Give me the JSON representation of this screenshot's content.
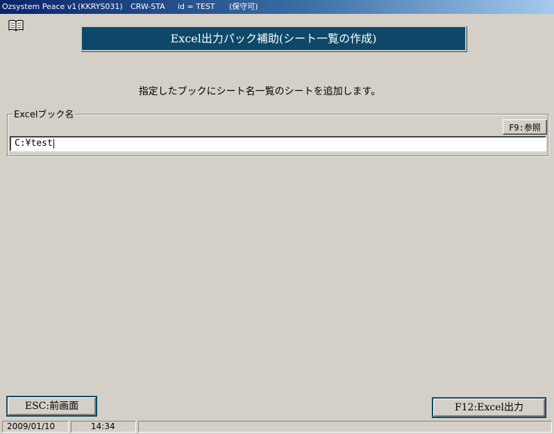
{
  "window": {
    "app_name": "Ozsystem Peace v1",
    "program_id": "(KKRYS031)",
    "station": "CRW-STA",
    "user": "id = TEST",
    "mode": "(保守可)"
  },
  "icons": {
    "manual": "book-icon"
  },
  "header": {
    "title": "Excel出力パック補助(シート一覧の作成)"
  },
  "main": {
    "instruction": "指定したブックにシート名一覧のシートを追加します。"
  },
  "excel_book": {
    "group_label": "Excelブック名",
    "browse_label": "F9:参照",
    "path_value": "C:¥test"
  },
  "footer": {
    "back_label": "ESC:前画面",
    "export_label": "F12:Excel出力"
  },
  "status": {
    "date": "2009/01/10",
    "time": "14:34",
    "message": ""
  },
  "colors": {
    "banner": "#0e4868",
    "background": "#d4d0c8",
    "titlebar": "#0a246a"
  }
}
